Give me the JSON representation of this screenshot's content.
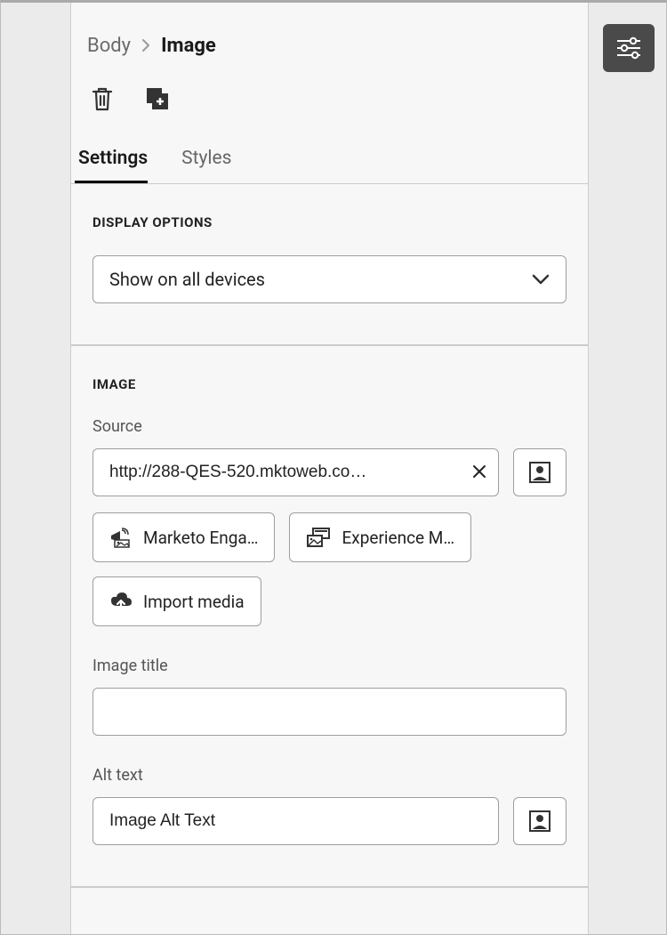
{
  "breadcrumb": {
    "parent": "Body",
    "current": "Image"
  },
  "tabs": {
    "settings": "Settings",
    "styles": "Styles"
  },
  "sections": {
    "display": {
      "label": "DISPLAY OPTIONS",
      "selected": "Show on all devices"
    },
    "image": {
      "label": "IMAGE",
      "source_label": "Source",
      "source_value": "http://288-QES-520.mktoweb.co…",
      "marketo_btn": "Marketo Enga…",
      "experience_btn": "Experience M…",
      "import_btn": "Import media",
      "title_label": "Image title",
      "title_value": "",
      "alt_label": "Alt text",
      "alt_value": "Image Alt Text"
    }
  }
}
